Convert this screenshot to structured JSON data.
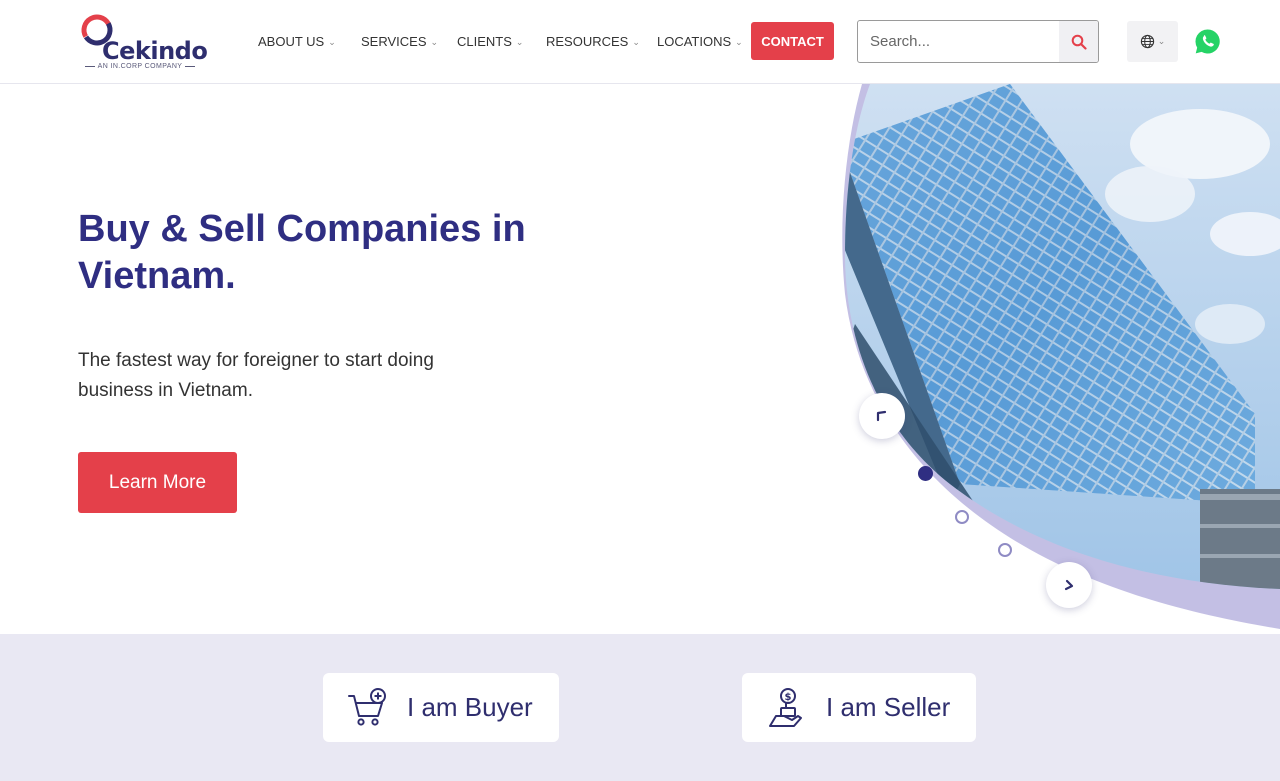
{
  "brand": {
    "name": "Cekindo",
    "tagline": "AN IN.CORP COMPANY",
    "colors": {
      "navy": "#2f2e82",
      "red": "#e4404a",
      "lavender": "#e9e8f3",
      "whatsapp": "#25d366"
    }
  },
  "nav": {
    "items": [
      {
        "label": "ABOUT US",
        "name": "nav-about-us"
      },
      {
        "label": "SERVICES",
        "name": "nav-services"
      },
      {
        "label": "CLIENTS",
        "name": "nav-clients"
      },
      {
        "label": "RESOURCES",
        "name": "nav-resources"
      },
      {
        "label": "LOCATIONS",
        "name": "nav-locations"
      }
    ],
    "contact_label": "CONTACT"
  },
  "search": {
    "placeholder": "Search...",
    "value": "",
    "icon": "search-icon"
  },
  "header_icons": {
    "language": "globe-icon",
    "chat": "whatsapp-icon"
  },
  "hero": {
    "title": "Buy & Sell Companies in Vietnam.",
    "subtitle": "The fastest way for foreigner to start doing business in Vietnam.",
    "cta_label": "Learn More",
    "slider": {
      "slide_count": 3,
      "active_slide": 1,
      "prev_icon": "chevron-up-icon",
      "next_icon": "chevron-down-icon"
    }
  },
  "choices": [
    {
      "label": "I am Buyer",
      "icon": "cart-plus-icon"
    },
    {
      "label": "I am Seller",
      "icon": "money-hand-icon"
    }
  ]
}
